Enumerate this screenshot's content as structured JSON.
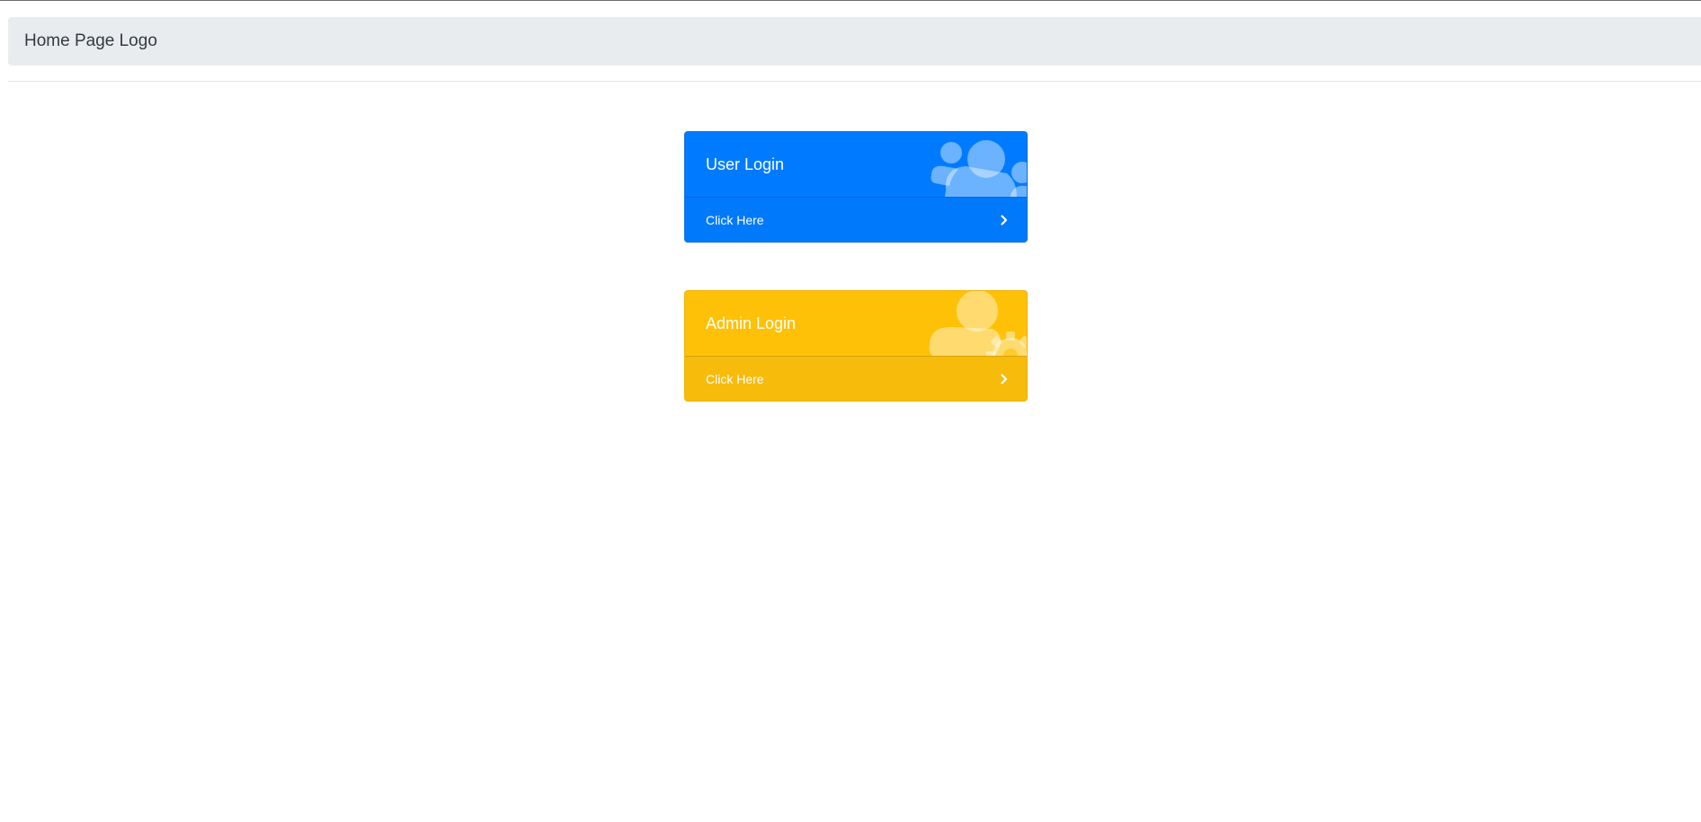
{
  "navbar": {
    "brand": "Home Page Logo"
  },
  "cards": [
    {
      "id": "user",
      "title": "User Login",
      "link": "Click Here",
      "icon": "users-icon",
      "color": "#007bff"
    },
    {
      "id": "admin",
      "title": "Admin Login",
      "link": "Click Here",
      "icon": "user-cog-icon",
      "color": "#ffc107"
    }
  ],
  "icons": {
    "chevron": "chevron-right-icon"
  }
}
